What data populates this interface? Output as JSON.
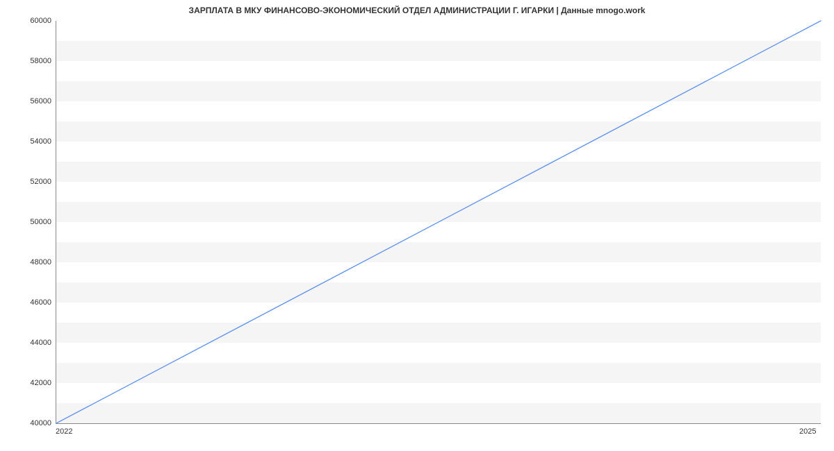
{
  "chart_data": {
    "type": "line",
    "title": "ЗАРПЛАТА В МКУ ФИНАНСОВО-ЭКОНОМИЧЕСКИЙ ОТДЕЛ АДМИНИСТРАЦИИ Г. ИГАРКИ | Данные mnogo.work",
    "x": [
      2022,
      2025
    ],
    "values": [
      40000,
      60000
    ],
    "x_ticks": [
      2022,
      2025
    ],
    "y_ticks": [
      40000,
      42000,
      44000,
      46000,
      48000,
      50000,
      52000,
      54000,
      56000,
      58000,
      60000
    ],
    "xlim": [
      2022,
      2025
    ],
    "ylim": [
      40000,
      60000
    ],
    "xlabel": "",
    "ylabel": "",
    "line_color": "#6495ed"
  }
}
